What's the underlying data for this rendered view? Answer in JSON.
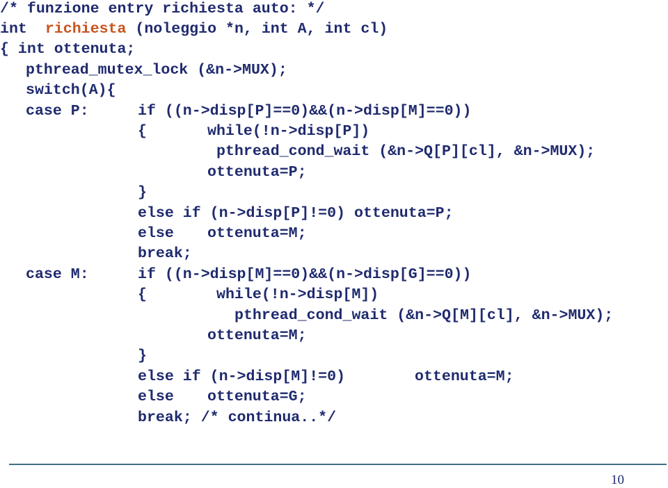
{
  "slide": {
    "lines": {
      "l1": "/* funzione entry richiesta auto: */",
      "l2_kw": "int",
      "l2_fn": "richiesta",
      "l2_rest": "(noleggio *n, int A, int cl)",
      "l3": "{ int ottenuta;",
      "l4": "pthread_mutex_lock (&n->MUX);",
      "l5": "switch(A){",
      "l6_label": "case P:",
      "l6": "if ((n->disp[P]==0)&&(n->disp[M]==0))",
      "l7_brace": "{",
      "l7": "while(!n->disp[P])",
      "l8": "pthread_cond_wait (&n->Q[P][cl], &n->MUX);",
      "l9": "ottenuta=P;",
      "l10": "}",
      "l11": "else if (n->disp[P]!=0) ottenuta=P;",
      "l12_kw": "else",
      "l12": "ottenuta=M;",
      "l13": "break;",
      "l14_label": "case M:",
      "l14": "if ((n->disp[M]==0)&&(n->disp[G]==0))",
      "l15_brace": "{",
      "l15": "while(!n->disp[M])",
      "l16": "pthread_cond_wait (&n->Q[M][cl], &n->MUX);",
      "l17": "ottenuta=M;",
      "l18": "}",
      "l19": "else if (n->disp[M]!=0)",
      "l19_b": "ottenuta=M;",
      "l20_kw": "else",
      "l20": "ottenuta=G;",
      "l21": "break; /* continua..*/"
    },
    "page_number": "10",
    "colors": {
      "text": "#1f2a6e",
      "function_name": "#c8541e",
      "rule": "#3f6f84"
    }
  }
}
